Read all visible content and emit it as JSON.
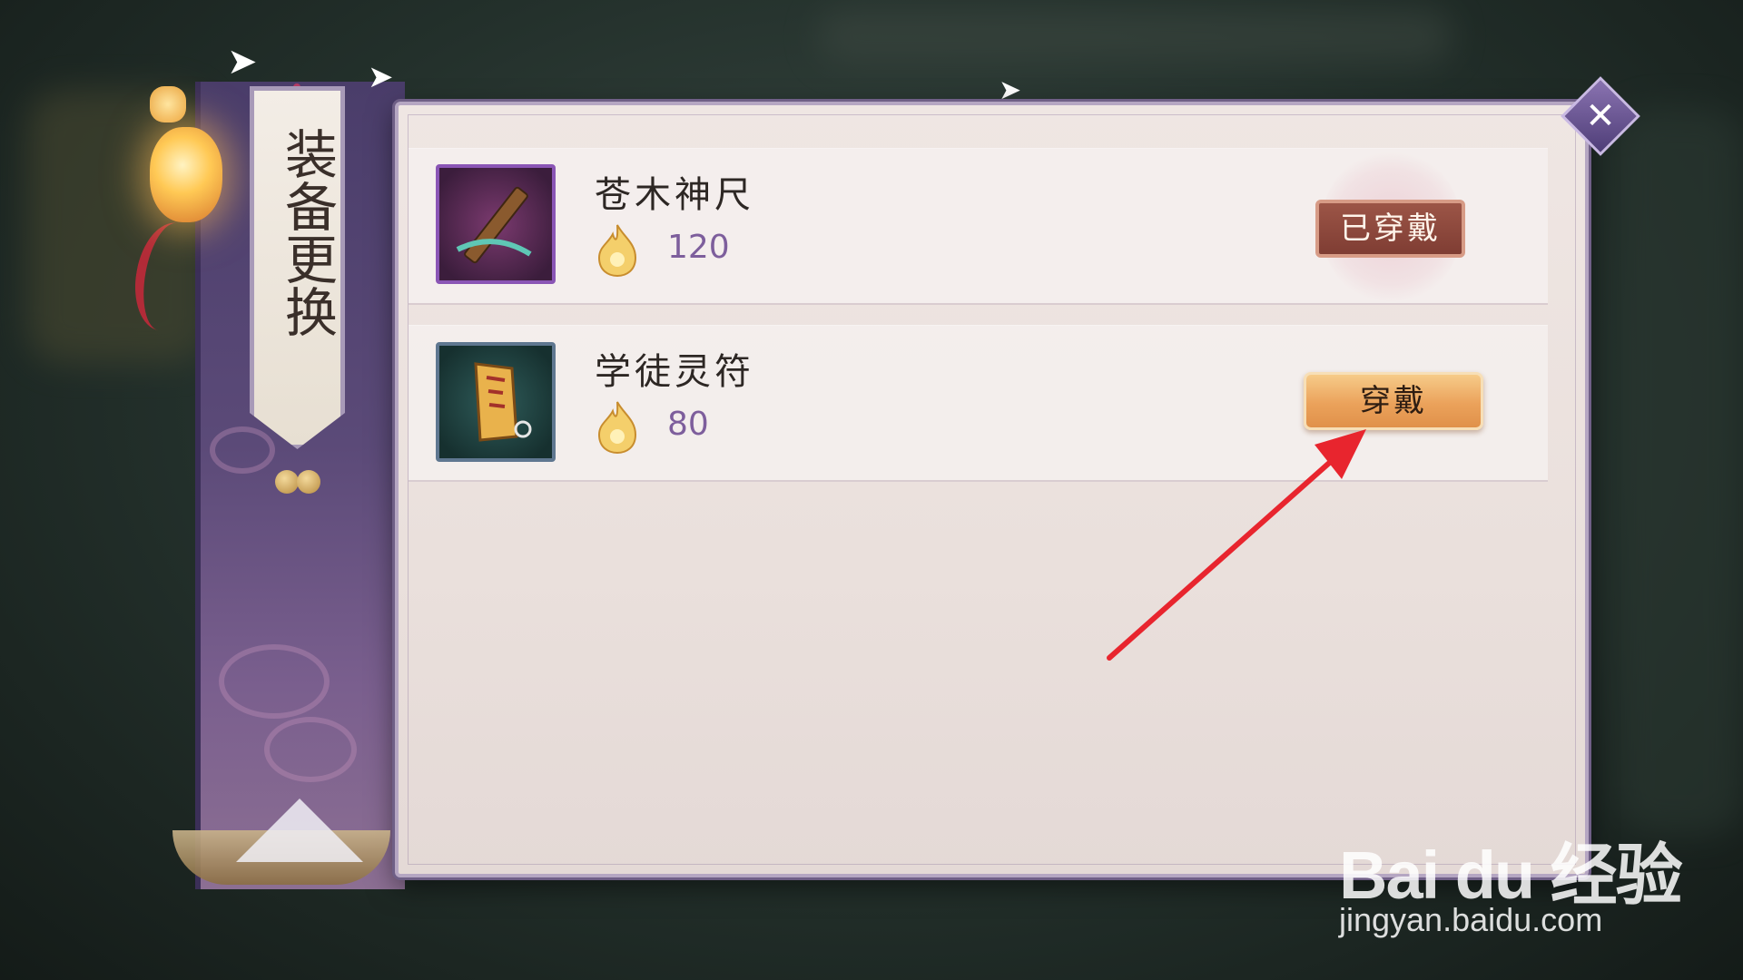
{
  "dialog": {
    "title": "装备更换",
    "close_icon": "close-x-icon"
  },
  "items": [
    {
      "name": "苍木神尺",
      "icon": "wooden-ruler-weapon-icon",
      "currency_icon": "gold-flame-icon",
      "value": "120",
      "status_button": "已穿戴",
      "equipped": true
    },
    {
      "name": "学徒灵符",
      "icon": "talisman-scroll-icon",
      "currency_icon": "gold-flame-icon",
      "value": "80",
      "action_button": "穿戴",
      "equipped": false
    }
  ],
  "annotation": {
    "type": "red-arrow",
    "target": "equip-button",
    "color": "#e8252e"
  },
  "watermark": {
    "logo": "Bai du 经验",
    "url": "jingyan.baidu.com"
  },
  "colors": {
    "panel_bg": "#eae0dc",
    "sidebar_purple": "#5b4a78",
    "value_purple": "#7d5e9c",
    "equip_button_orange": "#eba25b",
    "worn_badge_red": "#8c4639"
  }
}
